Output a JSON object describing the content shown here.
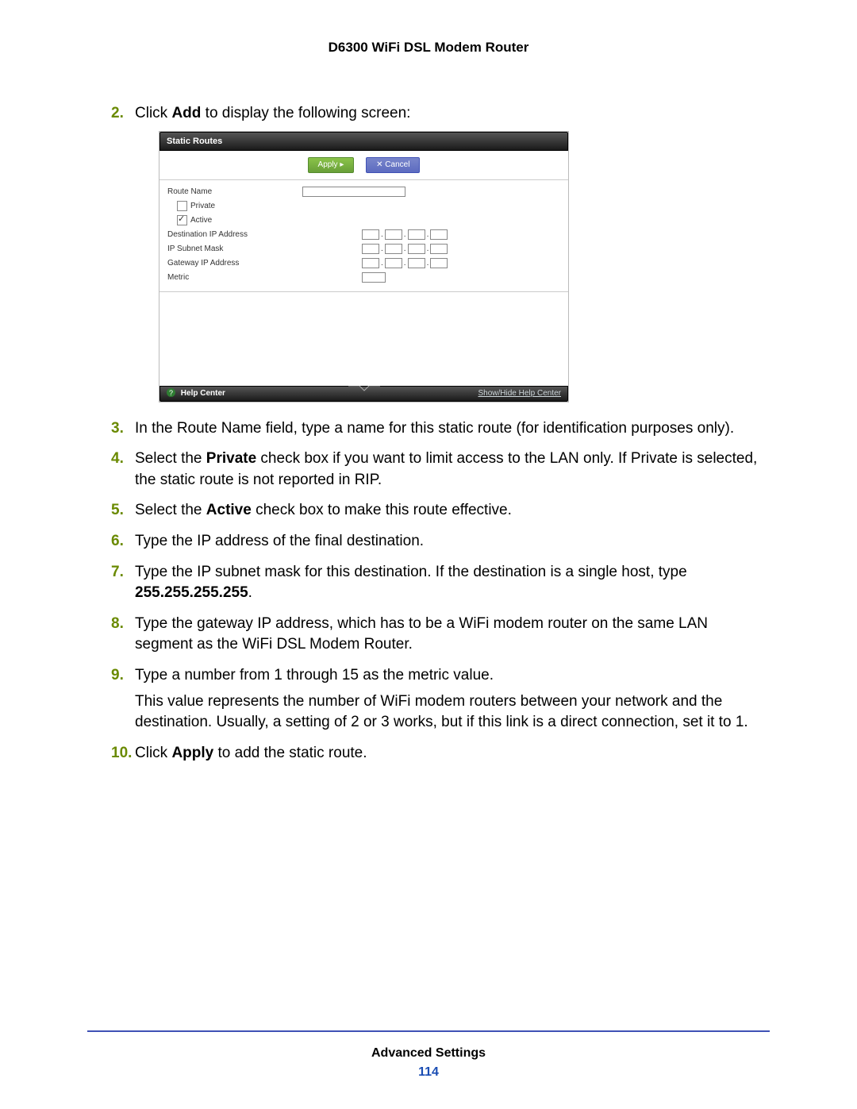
{
  "doc_title": "D6300 WiFi DSL Modem Router",
  "panel": {
    "title": "Static Routes",
    "apply": "Apply ▸",
    "cancel": "✕ Cancel",
    "labels": {
      "route_name": "Route Name",
      "private": "Private",
      "active": "Active",
      "dest_ip": "Destination IP Address",
      "subnet": "IP Subnet Mask",
      "gateway": "Gateway IP Address",
      "metric": "Metric"
    },
    "help": "Help Center",
    "showhide": "Show/Hide Help Center"
  },
  "steps": {
    "s2": {
      "num": "2.",
      "pre": "Click ",
      "b": "Add",
      "post": " to display the following screen:"
    },
    "s3": {
      "num": "3.",
      "text": "In the Route Name field, type a name for this static route (for identification purposes only)."
    },
    "s4": {
      "num": "4.",
      "pre": "Select the ",
      "b": "Private",
      "post": " check box if you want to limit access to the LAN only. If Private is selected, the static route is not reported in RIP."
    },
    "s5": {
      "num": "5.",
      "pre": "Select the ",
      "b": "Active",
      "post": " check box to make this route effective."
    },
    "s6": {
      "num": "6.",
      "text": "Type the IP address of the final destination."
    },
    "s7": {
      "num": "7.",
      "pre": "Type the IP subnet mask for this destination. If the destination is a single host, type ",
      "b": "255.255.255.255",
      "post": "."
    },
    "s8": {
      "num": "8.",
      "text": "Type the gateway IP address, which has to be a WiFi modem router on the same LAN segment as the WiFi DSL Modem Router."
    },
    "s9": {
      "num": "9.",
      "text": "Type a number from 1 through 15 as the metric value.",
      "cont": "This value represents the number of WiFi modem routers between your network and the destination. Usually, a setting of 2 or 3 works, but if this link is a direct connection, set it to 1."
    },
    "s10": {
      "num": "10.",
      "pre": "Click ",
      "b": "Apply",
      "post": " to add the static route."
    }
  },
  "footer": {
    "section": "Advanced Settings",
    "page": "114"
  }
}
